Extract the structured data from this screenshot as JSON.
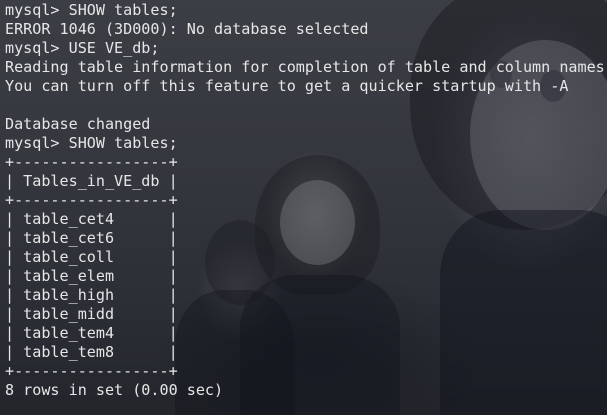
{
  "terminal": {
    "lines": [
      "mysql> SHOW tables;",
      "ERROR 1046 (3D000): No database selected",
      "mysql> USE VE_db;",
      "Reading table information for completion of table and column names",
      "You can turn off this feature to get a quicker startup with -A",
      "",
      "Database changed",
      "mysql> SHOW tables;",
      "+-----------------+",
      "| Tables_in_VE_db |",
      "+-----------------+",
      "| table_cet4      |",
      "| table_cet6      |",
      "| table_coll      |",
      "| table_elem      |",
      "| table_high      |",
      "| table_midd      |",
      "| table_tem4      |",
      "| table_tem8      |",
      "+-----------------+",
      "8 rows in set (0.00 sec)"
    ]
  },
  "colors": {
    "text": "#e6e6e6",
    "background": "#34373d"
  }
}
